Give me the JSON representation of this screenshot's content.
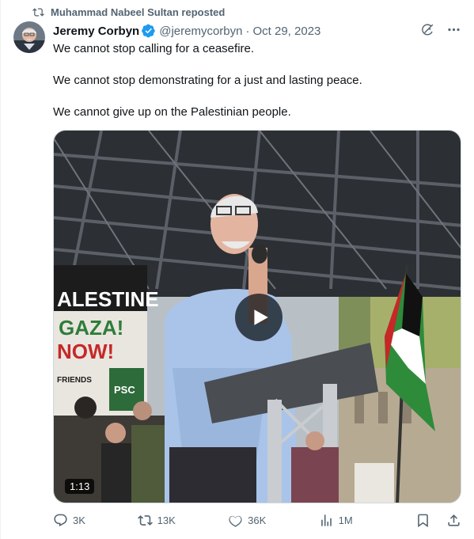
{
  "repost": {
    "text": "Muhammad Nabeel Sultan reposted",
    "icon": "repost-icon"
  },
  "author": {
    "name": "Jeremy Corbyn",
    "handle": "@jeremycorbyn",
    "separator": "·",
    "date": "Oct 29, 2023",
    "verified_color": "#1d9bf0"
  },
  "tweet": {
    "lines": [
      "We cannot stop calling for a ceasefire.",
      "We cannot stop demonstrating for a just and lasting peace.",
      "We cannot give up on the Palestinian people."
    ]
  },
  "media": {
    "duration": "1:13",
    "banner_text": [
      "ALESTINE",
      "GAZA!",
      "NOW!",
      "FRIENDS",
      "PSC"
    ]
  },
  "actions": {
    "replies": "3K",
    "reposts": "13K",
    "likes": "36K",
    "views": "1M"
  },
  "colors": {
    "secondary_text": "#536471",
    "accent": "#1d9bf0"
  }
}
